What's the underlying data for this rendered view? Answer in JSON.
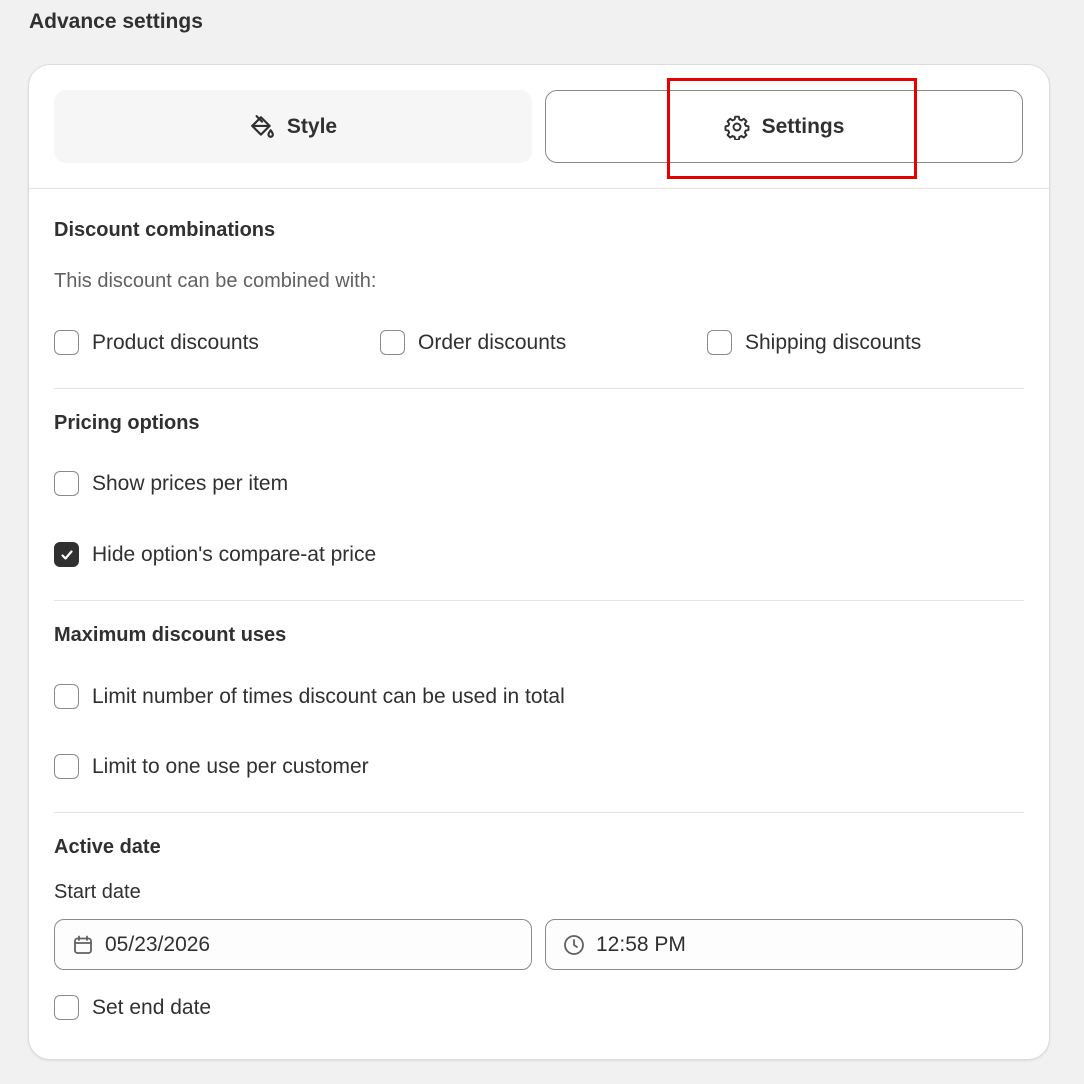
{
  "page": {
    "title": "Advance settings"
  },
  "tabs": {
    "style": {
      "label": "Style",
      "icon": "paint-bucket-icon"
    },
    "settings": {
      "label": "Settings",
      "icon": "gear-icon",
      "active": true
    }
  },
  "discount_combinations": {
    "title": "Discount combinations",
    "description": "This discount can be combined with:",
    "options": [
      {
        "label": "Product discounts",
        "checked": false
      },
      {
        "label": "Order discounts",
        "checked": false
      },
      {
        "label": "Shipping discounts",
        "checked": false
      }
    ]
  },
  "pricing_options": {
    "title": "Pricing options",
    "options": [
      {
        "label": "Show prices per item",
        "checked": false
      },
      {
        "label": "Hide option's compare-at price",
        "checked": true
      }
    ]
  },
  "max_uses": {
    "title": "Maximum discount uses",
    "options": [
      {
        "label": "Limit number of times discount can be used in total",
        "checked": false
      },
      {
        "label": "Limit to one use per customer",
        "checked": false
      }
    ]
  },
  "active_date": {
    "title": "Active date",
    "start_label": "Start date",
    "start_date": "05/23/2026",
    "start_time": "12:58 PM",
    "end_option": {
      "label": "Set end date",
      "checked": false
    }
  },
  "colors": {
    "highlight": "#e60000",
    "checkbox_checked": "#303030",
    "text": "#303030"
  }
}
